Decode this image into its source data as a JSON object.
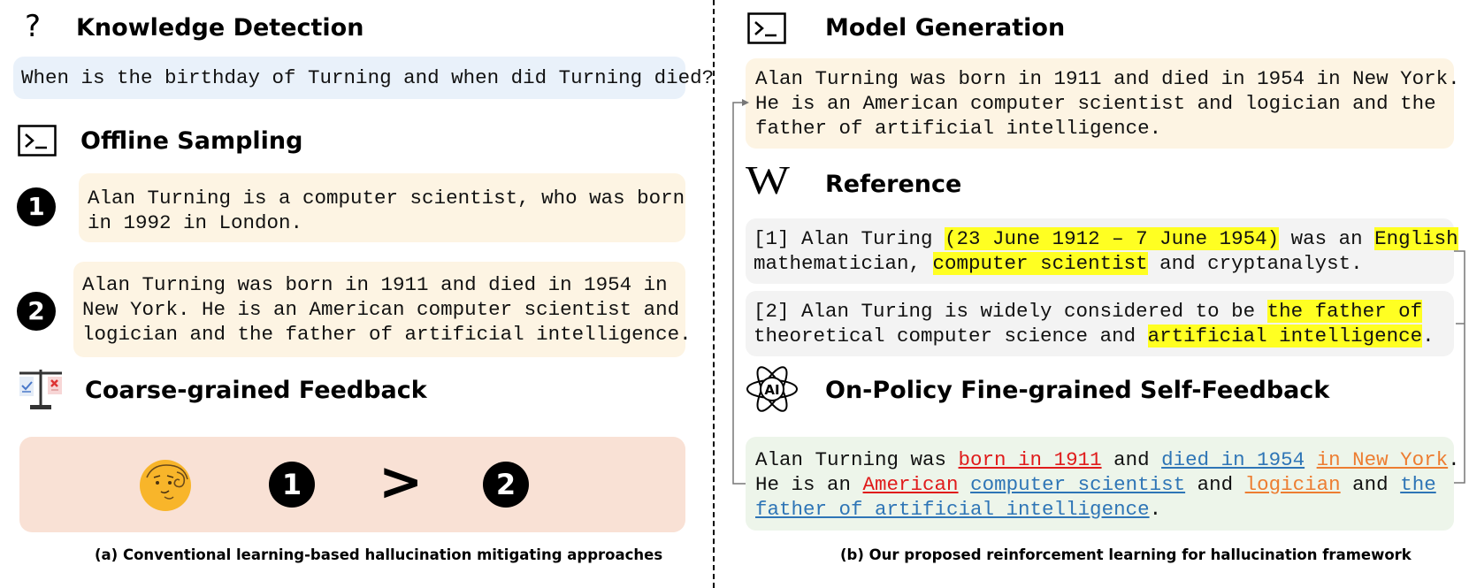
{
  "left": {
    "knowledge_detection": {
      "title": "Knowledge Detection",
      "query": "When is the birthday of Turning and when did Turning died?"
    },
    "offline_sampling": {
      "title": "Offline Sampling",
      "sample1_number": "1",
      "sample1_lines": [
        "Alan Turning is a computer scientist, who was born",
        "in 1992 in London."
      ],
      "sample2_number": "2",
      "sample2_lines": [
        "Alan Turning was born in 1911 and died in 1954 in",
        "New York. He is an American computer scientist and",
        "logician and the father of artificial intelligence."
      ]
    },
    "coarse_feedback": {
      "title": "Coarse-grained Feedback",
      "first": "1",
      "comparator": ">",
      "second": "2"
    },
    "caption": "(a) Conventional learning-based hallucination mitigating approaches"
  },
  "right": {
    "model_generation": {
      "title": "Model Generation",
      "lines": [
        "Alan Turning was born in 1911 and died in 1954 in New York.",
        "He is an American computer scientist and logician and the",
        "father of artificial intelligence."
      ]
    },
    "reference": {
      "title": "Reference",
      "icon_letter": "W",
      "ref1": {
        "p1": "[1] Alan Turing ",
        "h1": "(23 June 1912 – 7 June 1954)",
        "p2": " was an ",
        "h2": "English",
        "p3": "mathematician, ",
        "h3": "computer scientist",
        "p4": " and cryptanalyst."
      },
      "ref2": {
        "p1": "[2] Alan Turing is widely considered to be ",
        "h1": "the father of ",
        "p2": "theoretical computer science and ",
        "h2": "artificial intelligence",
        "p3": "."
      }
    },
    "self_feedback": {
      "title": "On-Policy Fine-grained Self-Feedback",
      "icon_text": "AI",
      "segs": {
        "a": "Alan Turning was ",
        "b": "born in 1911",
        "c": " and ",
        "d": "died in 1954",
        "e": " ",
        "f": "in New York",
        "g": ".",
        "h": "He is an ",
        "i": "American",
        "j": " ",
        "k": "computer scientist",
        "l": " and ",
        "m": "logician",
        "n": " and ",
        "o": "the",
        "p": "father of artificial intelligence",
        "q": "."
      }
    },
    "caption": "(b) Our proposed reinforcement learning for hallucination framework"
  },
  "colors": {
    "highlight": "#ffff22",
    "incorrect": "#e01b1b",
    "correct": "#2e75b6",
    "unverified": "#ed7d31"
  }
}
